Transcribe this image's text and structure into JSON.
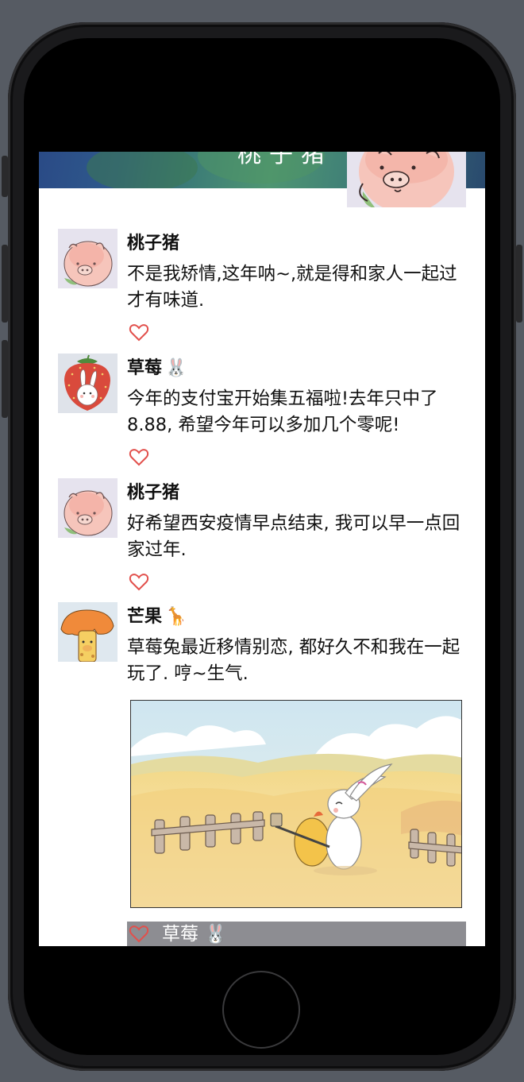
{
  "cover": {
    "title": "桃子猪"
  },
  "posts": [
    {
      "name": "桃子猪",
      "emoji": "",
      "content": "不是我矫情,这年呐~,就是得和家人一起过才有味道.",
      "avatar": "peach-pig"
    },
    {
      "name": "草莓",
      "emoji": "🐰",
      "content": "今年的支付宝开始集五福啦!去年只中了8.88, 希望今年可以多加几个零呢!",
      "avatar": "strawberry-bunny"
    },
    {
      "name": "桃子猪",
      "emoji": "",
      "content": "好希望西安疫情早点结束, 我可以早一点回家过年.",
      "avatar": "peach-pig"
    },
    {
      "name": "芒果",
      "emoji": "🦒",
      "content": "草莓兔最近移情别恋, 都好久不和我在一起玩了. 哼~生气.",
      "avatar": "mango-giraffe"
    }
  ],
  "comment": {
    "name": "草莓",
    "emoji": "🐰"
  },
  "colors": {
    "like": "#e2504c",
    "comment_bg": "#8d8d92",
    "phone": "#1a1a1c"
  },
  "icons": [
    "heart-icon",
    "home-button"
  ]
}
